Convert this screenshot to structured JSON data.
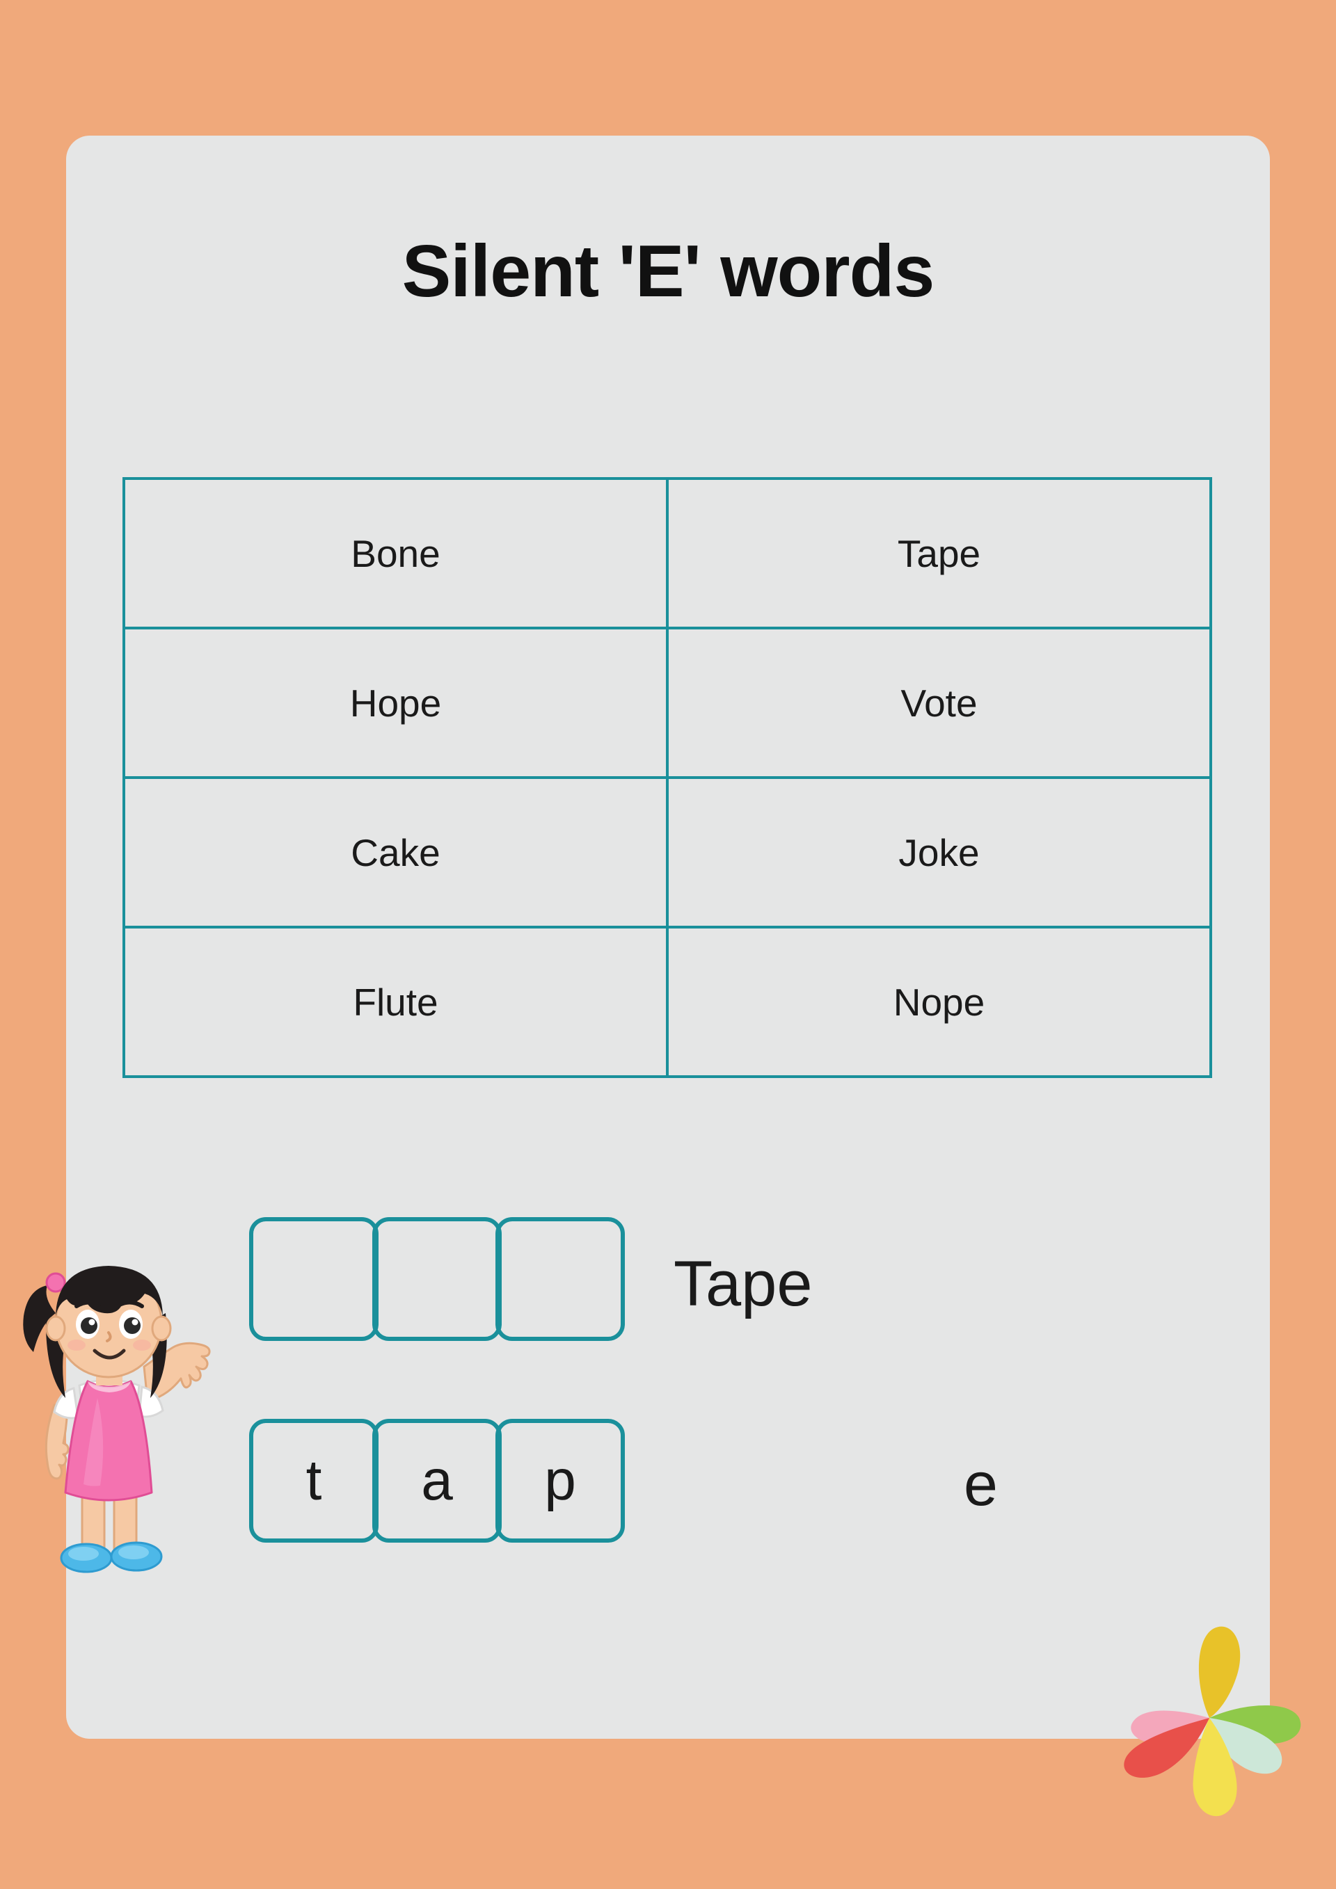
{
  "page": {
    "background_color": "#f0a97b",
    "card_color": "#e5e6e6",
    "accent_color": "#1a909b",
    "text_color": "#1a1a1a",
    "title": "Silent 'E' words"
  },
  "word_table": {
    "rows": [
      {
        "left": "Bone",
        "right": "Tape"
      },
      {
        "left": "Hope",
        "right": "Vote"
      },
      {
        "left": "Cake",
        "right": "Joke"
      },
      {
        "left": "Flute",
        "right": "Nope"
      }
    ]
  },
  "exercise": {
    "target_word": "Tape",
    "silent_e": "e",
    "blank_boxes": [
      "",
      "",
      ""
    ],
    "filled_boxes": [
      "t",
      "a",
      "p"
    ]
  },
  "decorations": {
    "girl": {
      "name": "waving-girl-illustration",
      "hair_color": "#211c1c",
      "skin_color": "#f6c9a4",
      "dress_color": "#f472b0",
      "shirt_color": "#ffffff",
      "shoe_color": "#4db8e8",
      "hairtie_color": "#f472b0"
    },
    "flower": {
      "name": "six-petal-flower",
      "petal_colors": [
        "#f4a7bb",
        "#e8c229",
        "#8fc94a",
        "#cde7d8",
        "#f3e04f",
        "#e8504a"
      ]
    }
  }
}
